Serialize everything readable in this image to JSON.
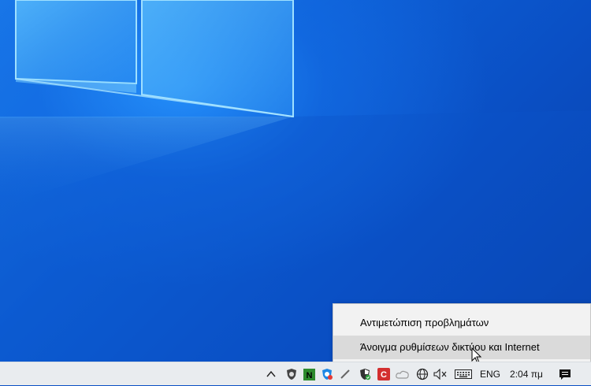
{
  "context_menu": {
    "items": [
      {
        "label": "Αντιμετώπιση προβλημάτων"
      },
      {
        "label": "Άνοιγμα ρυθμίσεων δικτύου και Internet"
      }
    ]
  },
  "taskbar": {
    "tray_icons": [
      "chevron-up-icon",
      "app-shield-icon",
      "nvidia-icon",
      "security-badge-icon",
      "pen-icon",
      "defender-shield-icon",
      "red-app-icon",
      "cloud-icon",
      "network-globe-icon",
      "speaker-muted-icon",
      "keyboard-icon"
    ],
    "language": "ENG",
    "clock": "2:04 πμ"
  },
  "colors": {
    "desktop": "#0a4fc4",
    "taskbar": "#e9ecef",
    "menu": "#f2f2f2",
    "menu_hover": "#dadada"
  }
}
